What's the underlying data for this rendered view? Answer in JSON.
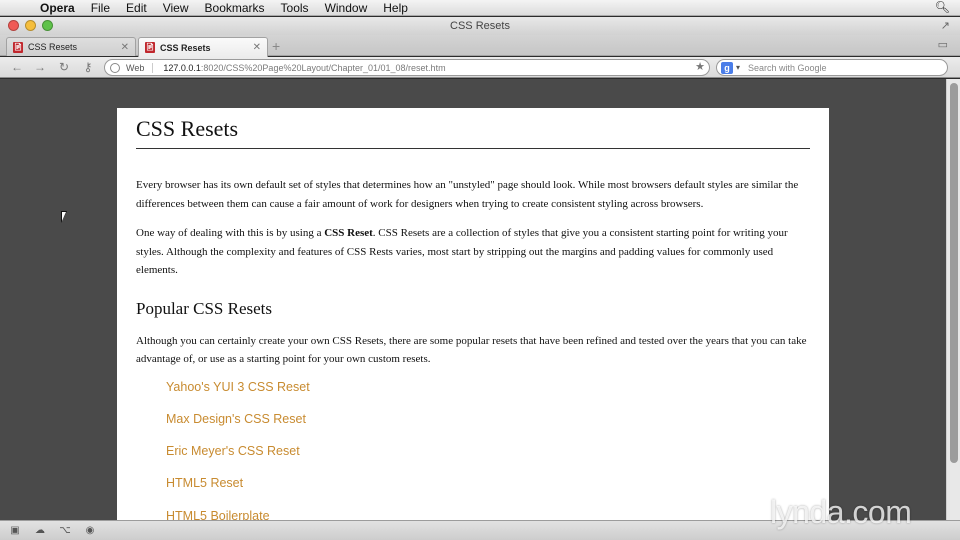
{
  "menubar": {
    "items": [
      "Opera",
      "File",
      "Edit",
      "View",
      "Bookmarks",
      "Tools",
      "Window",
      "Help"
    ]
  },
  "window": {
    "title": "CSS Resets"
  },
  "tabs": [
    {
      "label": "CSS Resets",
      "active": false
    },
    {
      "label": "CSS Resets",
      "active": true
    }
  ],
  "address": {
    "badge": "Web",
    "url_host": "127.0.0.1",
    "url_path": ":8020/CSS%20Page%20Layout/Chapter_01/01_08/reset.htm",
    "search_placeholder": "Search with Google"
  },
  "page": {
    "title": "CSS Resets",
    "p1": "Every browser has its own default set of styles that determines how an \"unstyled\" page should look. While most browsers default styles are similar the differences between them can cause a fair amount of work for designers when trying to create consistent styling across browsers.",
    "p2_before": "One way of dealing with this is by using a ",
    "p2_bold": "CSS Reset",
    "p2_after": ". CSS Resets are a collection of styles that give you a consistent starting point for writing your styles. Although the complexity and features of CSS Rests varies, most start by stripping out the margins and padding values for commonly used elements.",
    "subtitle": "Popular CSS Resets",
    "p3": "Although you can certainly create your own CSS Resets, there are some popular resets that have been refined and tested over the years that you can take advantage of, or use as a starting point for your own custom resets.",
    "links": [
      "Yahoo's YUI 3 CSS Reset",
      "Max Design's CSS Reset",
      "Eric Meyer's CSS Reset",
      "HTML5 Reset",
      "HTML5 Boilerplate"
    ],
    "link_color": "#c88b30"
  },
  "watermark": "lynda.com"
}
